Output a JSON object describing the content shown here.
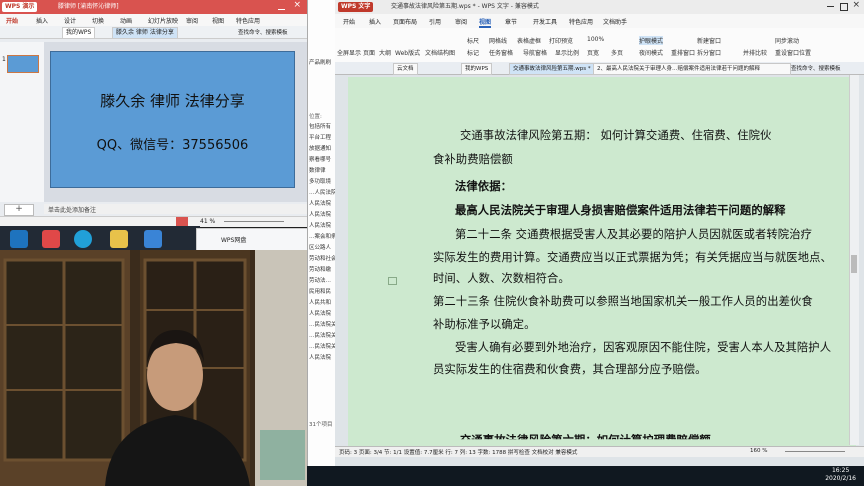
{
  "ppt": {
    "app_badge": "WPS 演示",
    "doc_title": "滕律师  [渝南怀沁律师]",
    "menu": [
      "开始",
      "插入",
      "设计",
      "切换",
      "动画",
      "幻灯片放映",
      "审阅",
      "视图",
      "特色应用"
    ],
    "tabs": [
      "我的WPS",
      "滕久余 律师 法律分享"
    ],
    "search": "查找命令、搜索模板",
    "slide_line1": "滕久余 律师 法律分享",
    "slide_line2": "QQ、微信号：37556506",
    "notes_hint": "单击此处添加备注",
    "zoom": "41 %",
    "add_label": "+"
  },
  "taskbar_pane": {
    "wps_net": "WPS网盘"
  },
  "folder": {
    "header": "位置:",
    "rows": [
      "产品刷刷",
      "包括所有",
      "平台工程",
      "放据通知",
      "察看哪号",
      "数律律",
      "多功取境",
      "…人民法院",
      "人民法院",
      "人民法院",
      "人民法院",
      "…案会和条",
      "区公路人",
      "劳动和社会",
      "劳动和缴",
      "劳动法…",
      "民用和民",
      "人民共和",
      "人民法院",
      "…民法院关",
      "…民法院关",
      "…民法院关",
      "人民法院"
    ],
    "footer": "31个项目"
  },
  "doc": {
    "app_badge": "WPS 文字",
    "doc_title": "交通事故法律风险第五期.wps * - WPS 文字 - 兼容模式",
    "menu": [
      "开始",
      "插入",
      "页面布局",
      "引用",
      "审阅",
      "视图",
      "章节",
      "开发工具",
      "特色应用",
      "文档助手"
    ],
    "ribbon": [
      "全屏显示",
      "页面",
      "大纲",
      "Web版式",
      "文档结构图",
      "标尺",
      "网格线",
      "表格虚框",
      "打印预览",
      "标记",
      "任务窗格",
      "导航窗格",
      "显示比例",
      "100%",
      "页宽",
      "多页",
      "护眼模式",
      "夜间模式",
      "重排窗口",
      "新建窗口",
      "拆分窗口",
      "并排比较",
      "同步滚动",
      "重设窗口位置"
    ],
    "tabs": [
      "云文档",
      "我的WPS",
      "交通事故法律风险第五期.wps *",
      "2、最高人民法院关于审理人身…赔偿案件适用法律若干问题的解释"
    ],
    "search": "查找命令、搜索模板",
    "lines": [
      "交通事故法律风险第五期：  如何计算交通费、住宿费、住院伙",
      "食补助费赔偿额",
      "法律依据：",
      "最高人民法院关于审理人身损害赔偿案件适用法律若干问题的解释",
      "第二十二条    交通费根据受害人及其必要的陪护人员因就医或者转院治疗",
      "实际发生的费用计算。交通费应当以正式票据为凭；有关凭据应当与就医地点、",
      "时间、人数、次数相符合。",
      "第二十三条    住院伙食补助费可以参照当地国家机关一般工作人员的出差伙食",
      "补助标准予以确定。",
      "受害人确有必要到外地治疗，因客观原因不能住院，受害人本人及其陪护人",
      "员实际发生的住宿费和伙食费，其合理部分应予赔偿。",
      "交通事故法律风险第六期：如何计算护理费赔偿额"
    ],
    "status": "页码: 3   页面: 3/4   节: 1/1   设置值: 7.7厘米   行: 7  列: 13   字数: 1788   拼写检查   文档校对   兼容模式",
    "zoom": "160 %"
  },
  "system": {
    "time": "16:25",
    "date": "2020/2/16"
  }
}
